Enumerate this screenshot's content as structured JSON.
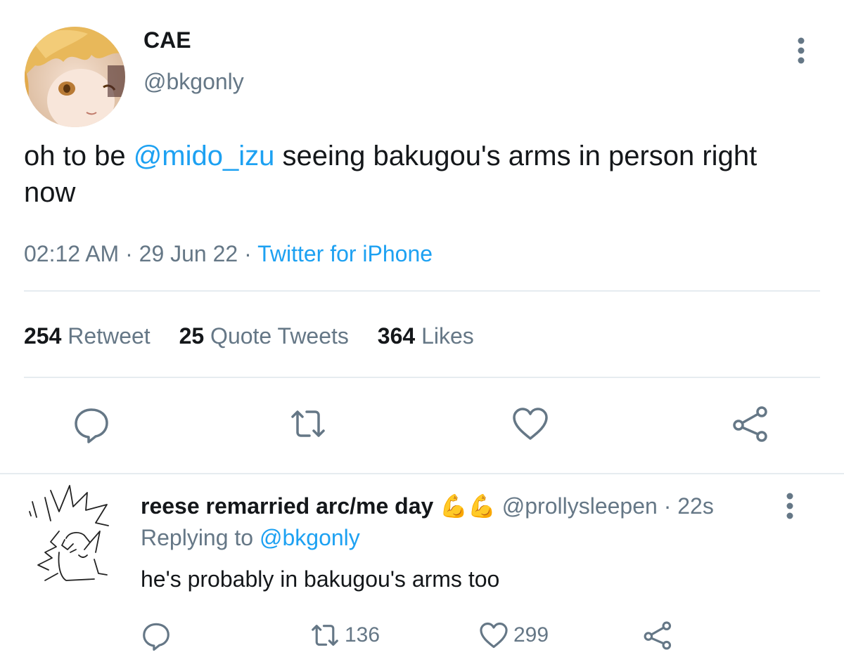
{
  "main_tweet": {
    "display_name": "CAE",
    "handle": "@bkgonly",
    "text_before": "oh to be ",
    "text_mention": "@mido_izu",
    "text_after": " seeing bakugou's arms in person right now",
    "time": "02:12 AM",
    "date": "29 Jun 22",
    "separator": " · ",
    "source": "Twitter for iPhone",
    "stats": {
      "retweets_count": "254",
      "retweets_label": "Retweet",
      "quotes_count": "25",
      "quotes_label": "Quote Tweets",
      "likes_count": "364",
      "likes_label": "Likes"
    }
  },
  "reply": {
    "display_name": "reese remarried arc/me day",
    "emoji": "💪💪",
    "handle": "@prollysleepen",
    "separator": " · ",
    "time_ago": "22s",
    "replying_label": "Replying to ",
    "replying_mention": "@bkgonly",
    "text": "he's probably in bakugou's arms too",
    "retweet_count": "136",
    "like_count": "299"
  },
  "colors": {
    "accent": "#1da1f2",
    "secondary_text": "#657786",
    "primary_text": "#14171a",
    "divider": "#e6ecf0"
  }
}
